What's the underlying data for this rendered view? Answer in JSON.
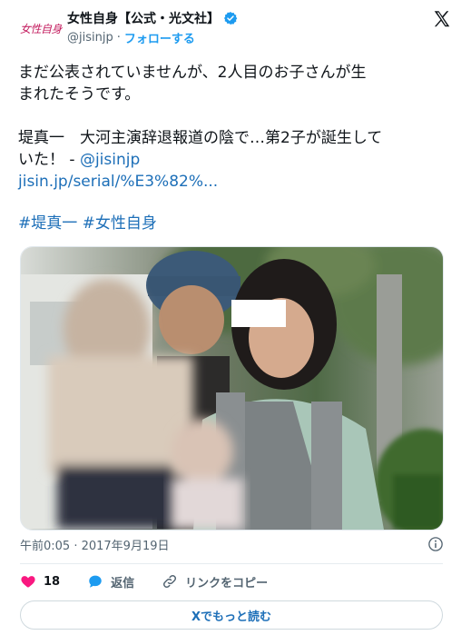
{
  "header": {
    "logo_text": "女性自身",
    "display_name": "女性自身【公式・光文社】",
    "handle": "@jisinjp",
    "separator": "·",
    "follow_label": "フォローする"
  },
  "tweet": {
    "lines": [
      "まだ公表されていませんが、2人目のお子さんが生",
      "まれたそうです。",
      "",
      "堤真一　大河主演辞退報道の陰で…第2子が誕生して",
      "いた！ - "
    ],
    "mention": "@jisinjp",
    "url": "jisin.jp/serial/%E3%82%...",
    "hashtags": "#堤真一 #女性自身"
  },
  "meta": {
    "time": "午前0:05 · 2017年9月19日"
  },
  "actions": {
    "like_count": "18",
    "reply_label": "返信",
    "copy_link_label": "リンクをコピー"
  },
  "readmore_label": "Xでもっと読む",
  "colors": {
    "link": "#1d6fb8",
    "like": "#f91880",
    "verified": "#1d9bf0"
  }
}
